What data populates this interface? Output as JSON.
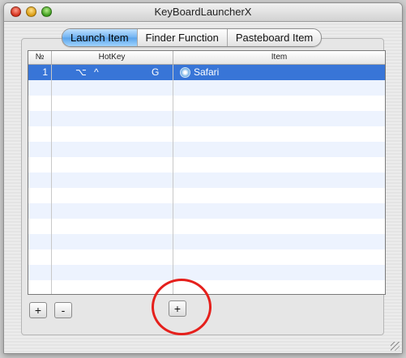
{
  "window": {
    "title": "KeyBoardLauncherX"
  },
  "tabs": [
    {
      "label": "Launch Item",
      "active": true
    },
    {
      "label": "Finder Function",
      "active": false
    },
    {
      "label": "Pasteboard Item",
      "active": false
    }
  ],
  "table": {
    "headers": {
      "no": "№",
      "hotkey": "HotKey",
      "item": "Item"
    },
    "rows": [
      {
        "num": "1",
        "mod1": "⌥",
        "mod2": "^",
        "key": "G",
        "item": "Safari",
        "item_icon": "safari-icon",
        "selected": true
      }
    ],
    "empty_row_count": 15
  },
  "buttons": {
    "add_hotkey": "+",
    "remove_hotkey": "-",
    "add_item": "+"
  },
  "colors": {
    "selection": "#3875d7",
    "stripe": "#edf3fe",
    "annotation": "#e5201c"
  }
}
